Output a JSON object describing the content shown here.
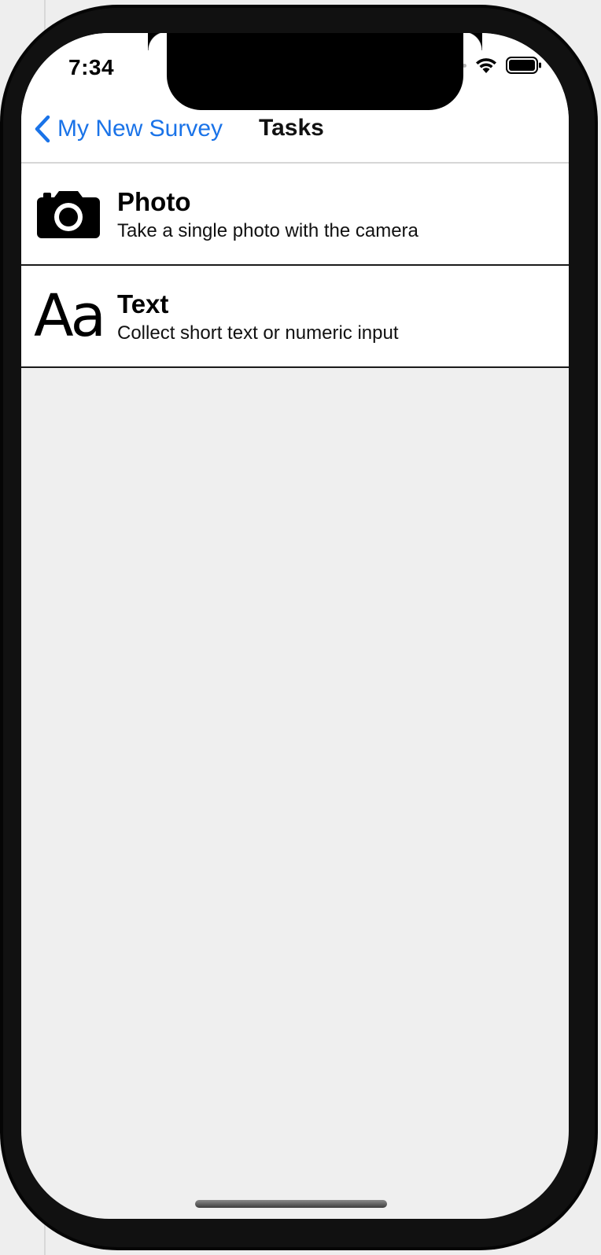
{
  "status_bar": {
    "time": "7:34",
    "wifi_icon": "wifi-icon",
    "battery_icon": "battery-icon"
  },
  "nav": {
    "back_label": "My New Survey",
    "back_icon": "chevron-left-icon",
    "title": "Tasks",
    "accent_color": "#1a73e8"
  },
  "tasks": [
    {
      "icon": "camera-icon",
      "title": "Photo",
      "subtitle": "Take a single photo with the camera"
    },
    {
      "icon": "text-format-icon",
      "icon_glyph": "Aa",
      "title": "Text",
      "subtitle": "Collect short text or numeric input"
    }
  ]
}
